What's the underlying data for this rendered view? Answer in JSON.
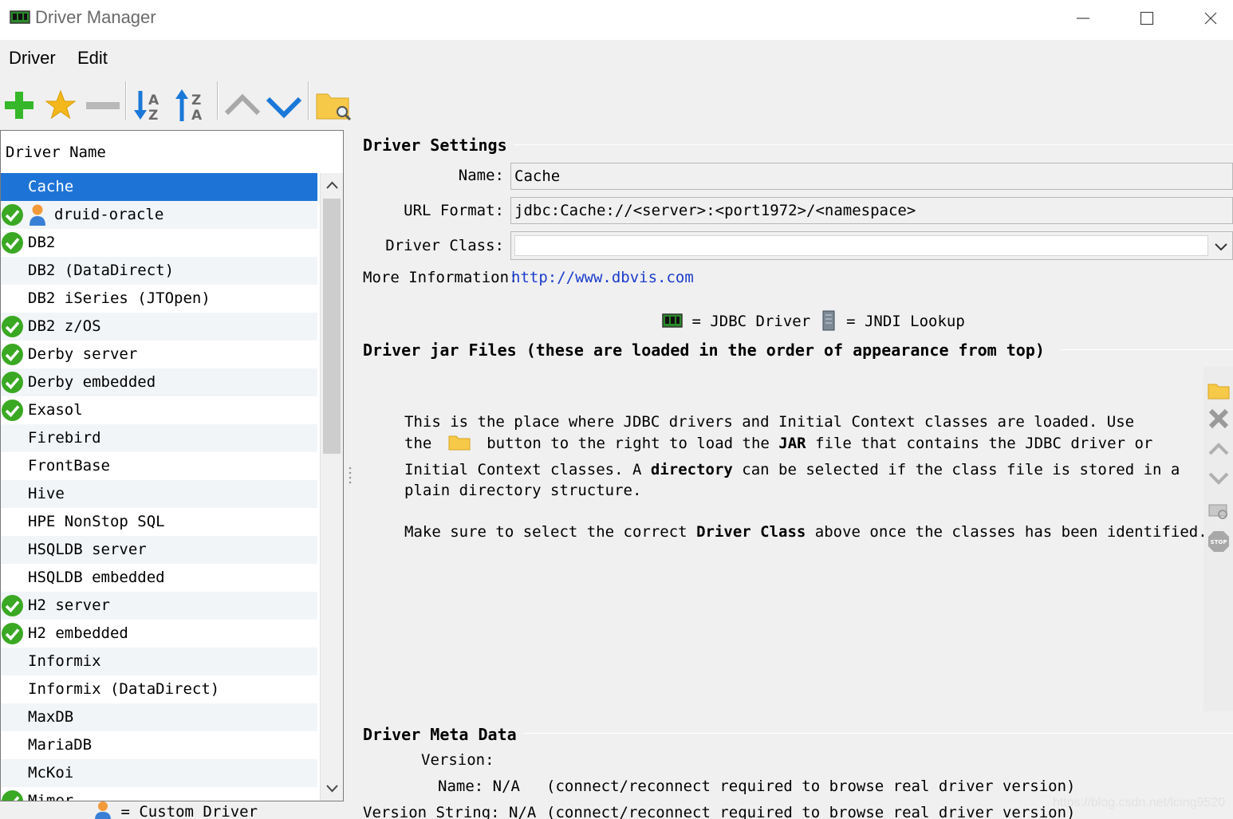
{
  "window": {
    "title": "Driver Manager"
  },
  "menu": {
    "items": [
      "Driver",
      "Edit"
    ]
  },
  "toolbar": {
    "icons": [
      "add-icon",
      "star-icon",
      "remove-icon",
      "sort-ascending-icon",
      "sort-descending-icon",
      "move-up-icon",
      "move-down-icon",
      "open-folder-icon"
    ]
  },
  "driver_list": {
    "header": "Driver Name",
    "rows": [
      {
        "label": "Cache",
        "verified": false,
        "custom": false,
        "selected": true
      },
      {
        "label": "druid-oracle",
        "verified": true,
        "custom": true,
        "selected": false
      },
      {
        "label": "DB2",
        "verified": true,
        "custom": false,
        "selected": false
      },
      {
        "label": "DB2 (DataDirect)",
        "verified": false,
        "custom": false,
        "selected": false
      },
      {
        "label": "DB2 iSeries (JTOpen)",
        "verified": false,
        "custom": false,
        "selected": false
      },
      {
        "label": "DB2 z/OS",
        "verified": true,
        "custom": false,
        "selected": false
      },
      {
        "label": "Derby server",
        "verified": true,
        "custom": false,
        "selected": false
      },
      {
        "label": "Derby embedded",
        "verified": true,
        "custom": false,
        "selected": false
      },
      {
        "label": "Exasol",
        "verified": true,
        "custom": false,
        "selected": false
      },
      {
        "label": "Firebird",
        "verified": false,
        "custom": false,
        "selected": false
      },
      {
        "label": "FrontBase",
        "verified": false,
        "custom": false,
        "selected": false
      },
      {
        "label": "Hive",
        "verified": false,
        "custom": false,
        "selected": false
      },
      {
        "label": "HPE NonStop SQL",
        "verified": false,
        "custom": false,
        "selected": false
      },
      {
        "label": "HSQLDB server",
        "verified": false,
        "custom": false,
        "selected": false
      },
      {
        "label": "HSQLDB embedded",
        "verified": false,
        "custom": false,
        "selected": false
      },
      {
        "label": "H2 server",
        "verified": true,
        "custom": false,
        "selected": false
      },
      {
        "label": "H2 embedded",
        "verified": true,
        "custom": false,
        "selected": false
      },
      {
        "label": "Informix",
        "verified": false,
        "custom": false,
        "selected": false
      },
      {
        "label": "Informix (DataDirect)",
        "verified": false,
        "custom": false,
        "selected": false
      },
      {
        "label": "MaxDB",
        "verified": false,
        "custom": false,
        "selected": false
      },
      {
        "label": "MariaDB",
        "verified": false,
        "custom": false,
        "selected": false
      },
      {
        "label": "McKoi",
        "verified": false,
        "custom": false,
        "selected": false
      },
      {
        "label": "Mimer",
        "verified": true,
        "custom": false,
        "selected": false
      }
    ],
    "legend": "= Custom Driver"
  },
  "settings": {
    "section_title": "Driver Settings",
    "name_label": "Name:",
    "name_value": "Cache",
    "url_label": "URL Format:",
    "url_value": "jdbc:Cache://<server>:<port1972>/<namespace>",
    "class_label": "Driver Class:",
    "class_value": "",
    "info_label": "More Information:",
    "info_link": "http://www.dbvis.com",
    "legend_jdbc": "= JDBC Driver",
    "legend_jndi": "= JNDI Lookup"
  },
  "jar_files": {
    "section_title": "Driver jar Files (these are loaded in the order of appearance from top)",
    "p1_line1": "This is the place where JDBC drivers and Initial Context classes are loaded. Use",
    "p1_line2_a": "the",
    "p1_line2_b": "button to the right to load the",
    "p1_line2_bold": "JAR",
    "p1_line2_c": "file that contains the JDBC driver or",
    "p1_line3_a": "Initial Context classes. A",
    "p1_line3_bold": "directory",
    "p1_line3_b": "can be selected if the class file is stored in a",
    "p1_line4": "plain directory structure.",
    "p2_a": "Make sure to select the correct",
    "p2_bold": "Driver Class",
    "p2_b": "above once the classes has been identified."
  },
  "meta": {
    "section_title": "Driver Meta Data",
    "version_label": "Version:",
    "name_label": "Name:",
    "name_value": "N/A",
    "name_note": "(connect/reconnect required to browse real driver version)",
    "vs_label": "Version String:",
    "vs_value": "N/A",
    "vs_note": "(connect/reconnect required to browse real driver version)"
  },
  "colors": {
    "selection": "#1e74d6",
    "link": "#1a3ccc",
    "check": "#3aa823",
    "add": "#35b729",
    "arrow_blue": "#1a78d8"
  },
  "watermark": "https://blog.csdn.net/lcing9520"
}
